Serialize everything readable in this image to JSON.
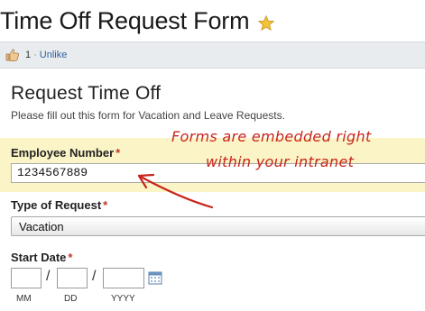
{
  "page": {
    "title": "Time Off Request Form",
    "favorite_icon": "star-icon"
  },
  "social": {
    "like_icon": "thumbs-up-icon",
    "like_count": "1",
    "separator": "·",
    "unlike_label": "Unlike"
  },
  "form": {
    "heading": "Request Time Off",
    "description": "Please fill out this form for Vacation and Leave Requests.",
    "employee_number": {
      "label": "Employee Number",
      "required_mark": "*",
      "value": "1234567889"
    },
    "request_type": {
      "label": "Type of Request",
      "required_mark": "*",
      "selected": "Vacation"
    },
    "start_date": {
      "label": "Start Date",
      "required_mark": "*",
      "separator": "/",
      "mm_hint": "MM",
      "dd_hint": "DD",
      "yyyy_hint": "YYYY",
      "calendar_icon": "calendar-icon"
    }
  },
  "annotation": {
    "line1": "Forms are embedded right",
    "line2": "within your intranet"
  },
  "colors": {
    "highlight": "#fbf4c6",
    "annotation": "#c8261b",
    "required": "#c0392b",
    "link": "#2f5f9a"
  }
}
